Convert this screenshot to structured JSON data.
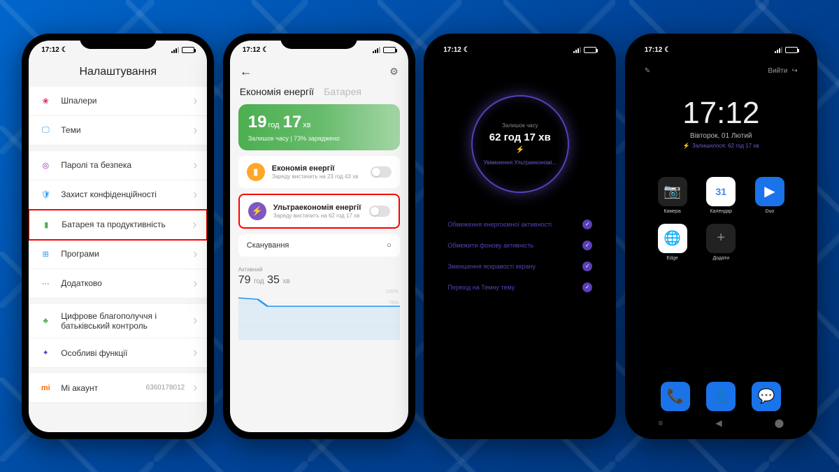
{
  "statusBar": {
    "time": "17:12"
  },
  "phone1": {
    "title": "Налаштування",
    "items": {
      "wallpaper": "Шпалери",
      "themes": "Теми",
      "passwords": "Паролі та безпека",
      "privacy": "Захист конфіденційності",
      "battery": "Батарея та продуктивність",
      "apps": "Програми",
      "additional": "Додатково",
      "wellbeing": "Цифрове благополуччя і батьківський контроль",
      "special": "Особливі функції",
      "account": "Mi акаунт",
      "accountId": "6360178012"
    }
  },
  "phone2": {
    "tabs": {
      "energy": "Економія енергії",
      "battery": "Батарея"
    },
    "card": {
      "hours": "19",
      "hoursUnit": "год",
      "mins": "17",
      "minsUnit": "хв",
      "sub": "Залишок часу | 73% заряджено"
    },
    "mode1": {
      "title": "Економія енергії",
      "sub": "Заряду вистачить на 23 год 43 хв"
    },
    "mode2": {
      "title": "Ультраекономія енергії",
      "sub": "Заряду вистачить на 62 год 17 хв"
    },
    "scan": "Сканування",
    "chart": {
      "activeLabel": "Активний",
      "hours": "79",
      "hoursUnit": "год",
      "mins": "35",
      "minsUnit": "хв",
      "y100": "100%",
      "y75": "75%"
    }
  },
  "chart_data": {
    "type": "line",
    "title": "Активний",
    "ylabel": "%",
    "ylim": [
      0,
      100
    ],
    "series": [
      {
        "name": "battery",
        "values": [
          90,
          88,
          73,
          73,
          73,
          73,
          73,
          73
        ]
      }
    ]
  },
  "phone3": {
    "circleLabel": "Залишок часу",
    "circleTime": "62 год 17 хв",
    "circleSub": "Увімкнення Ультраекономі...",
    "features": {
      "f1": "Обмеження енергоємної активності",
      "f2": "Обмежити фонову активність",
      "f3": "Зменшення яскравості екрану",
      "f4": "Перехід на Темну тему"
    }
  },
  "phone4": {
    "exit": "Вийти",
    "clock": "17:12",
    "date": "Вівторок, 01 Лютий",
    "remain": "Залишилося: 62 год 17 хв",
    "apps": {
      "camera": "Камера",
      "calendar": "Календар",
      "duo": "Duo",
      "edge": "Edge",
      "add": "Додати"
    }
  }
}
